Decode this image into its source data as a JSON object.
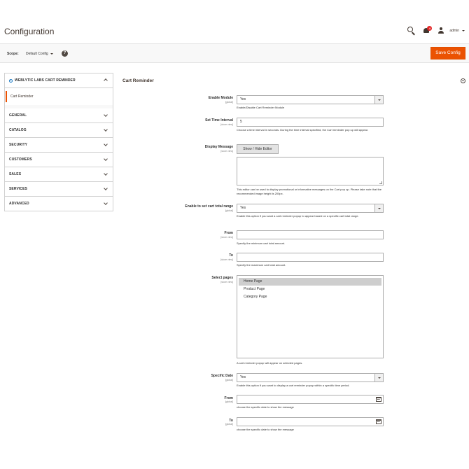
{
  "header": {
    "title": "Configuration",
    "notification_count": "4",
    "user_name": "admin"
  },
  "scope": {
    "label": "Scope:",
    "value": "Default Config",
    "help": "?"
  },
  "toolbar": {
    "save_label": "Save Config"
  },
  "sidebar": {
    "module_tab": "WEBLYTIC LABS CART REMINDER",
    "module_item": "Cart Reminder",
    "items": [
      {
        "label": "GENERAL"
      },
      {
        "label": "CATALOG"
      },
      {
        "label": "SECURITY"
      },
      {
        "label": "CUSTOMERS"
      },
      {
        "label": "SALES"
      },
      {
        "label": "SERVICES"
      },
      {
        "label": "ADVANCED"
      }
    ]
  },
  "section": {
    "title": "Cart Reminder"
  },
  "fields": {
    "enable_module": {
      "label": "Enable Module",
      "scope": "[global]",
      "value": "Yes",
      "note": "Enable/Disable Cart Reminder Module"
    },
    "time_interval": {
      "label": "Set Time Interval",
      "scope": "[store view]",
      "value": "5",
      "note": "Choose a time interval in seconds. During the time interval specified, the Cart reminder pop up will appear."
    },
    "display_message": {
      "label": "Display Message",
      "scope": "[store view]",
      "button": "Show / Hide Editor",
      "note": "This editor can be used to display promotional or informative messages on the Cart pop up. Please take note that the recommended image height is 200px."
    },
    "cart_total_range": {
      "label": "Enable to set cart total range",
      "scope": "[global]",
      "value": "Yes",
      "note": "Enable this option if you want a cart reminder popup to appear based on a specific cart total range."
    },
    "from_total": {
      "label": "From",
      "scope": "[store view]",
      "value": "",
      "note": "Specify the minimum cart total amount."
    },
    "to_total": {
      "label": "To",
      "scope": "[store view]",
      "value": "",
      "note": "Specify the maximum cart total amount."
    },
    "select_pages": {
      "label": "Select pages",
      "scope": "[store view]",
      "options": [
        "Home Page",
        "Product Page",
        "Category Page"
      ],
      "selected": "Home Page",
      "note": "A cart reminder popup will appear on selected pages."
    },
    "specific_date": {
      "label": "Specific Date",
      "scope": "[global]",
      "value": "Yes",
      "note": "Enable this option if you want to display a cart reminder popup within a specific time period."
    },
    "from_date": {
      "label": "From",
      "scope": "[global]",
      "value": "",
      "note": "choose the specific date to show the message"
    },
    "to_date": {
      "label": "To",
      "scope": "[global]",
      "value": "",
      "note": "choose the specific date to show the message"
    }
  }
}
